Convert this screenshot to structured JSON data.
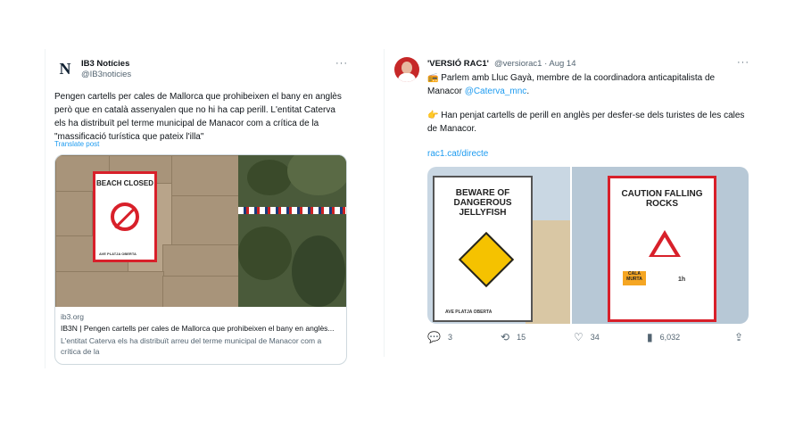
{
  "tweet1": {
    "avatar_letter": "N",
    "name": "IB3 Notícies",
    "handle": "@IB3noticies",
    "more": "···",
    "text": "Pengen cartells per cales de Mallorca que prohibeixen el bany en anglès però que en català assenyalen que no hi ha cap perill. L'entitat Caterva els ha distribuït pel terme municipal de Manacor com a crítica de la \"massificació turística que pateix l'illa\"",
    "translate_label": "Translate post",
    "sign_title": "BEACH CLOSED",
    "sign_footer": "AVE  PLATJA OBERTA",
    "card": {
      "domain": "ib3.org",
      "title": "IB3N | Pengen cartells per cales de Mallorca que prohibeixen el bany en anglès...",
      "description": "L'entitat Caterva els ha distribuït arreu del terme municipal de Manacor com a crítica de la"
    }
  },
  "tweet2": {
    "name": "'VERSIÓ RAC1'",
    "handle_time": "@versiorac1 · Aug 14",
    "more": "···",
    "line1_emoji": "📻",
    "line1_text": "Parlem amb Lluc Gayà, membre de la coordinadora anticapitalista de Manacor",
    "mention": "@Caterva_mnc",
    "line1_end": ".",
    "line2_emoji": "👉",
    "line2_text": "Han penjat cartells de perill en anglès per desfer-se dels turistes de les cales de Manacor.",
    "link": "rac1.cat/directe",
    "sign_left_title": "BEWARE OF DANGEROUS JELLYFISH",
    "sign_left_footer": "AVE  PLATJA OBERTA",
    "sign_right_title": "CAUTION FALLING ROCKS",
    "sign_right_cala": "CALA MURTA",
    "sign_right_time": "1h",
    "actions": {
      "replies": "3",
      "reposts": "15",
      "likes": "34",
      "views": "6,032"
    }
  }
}
